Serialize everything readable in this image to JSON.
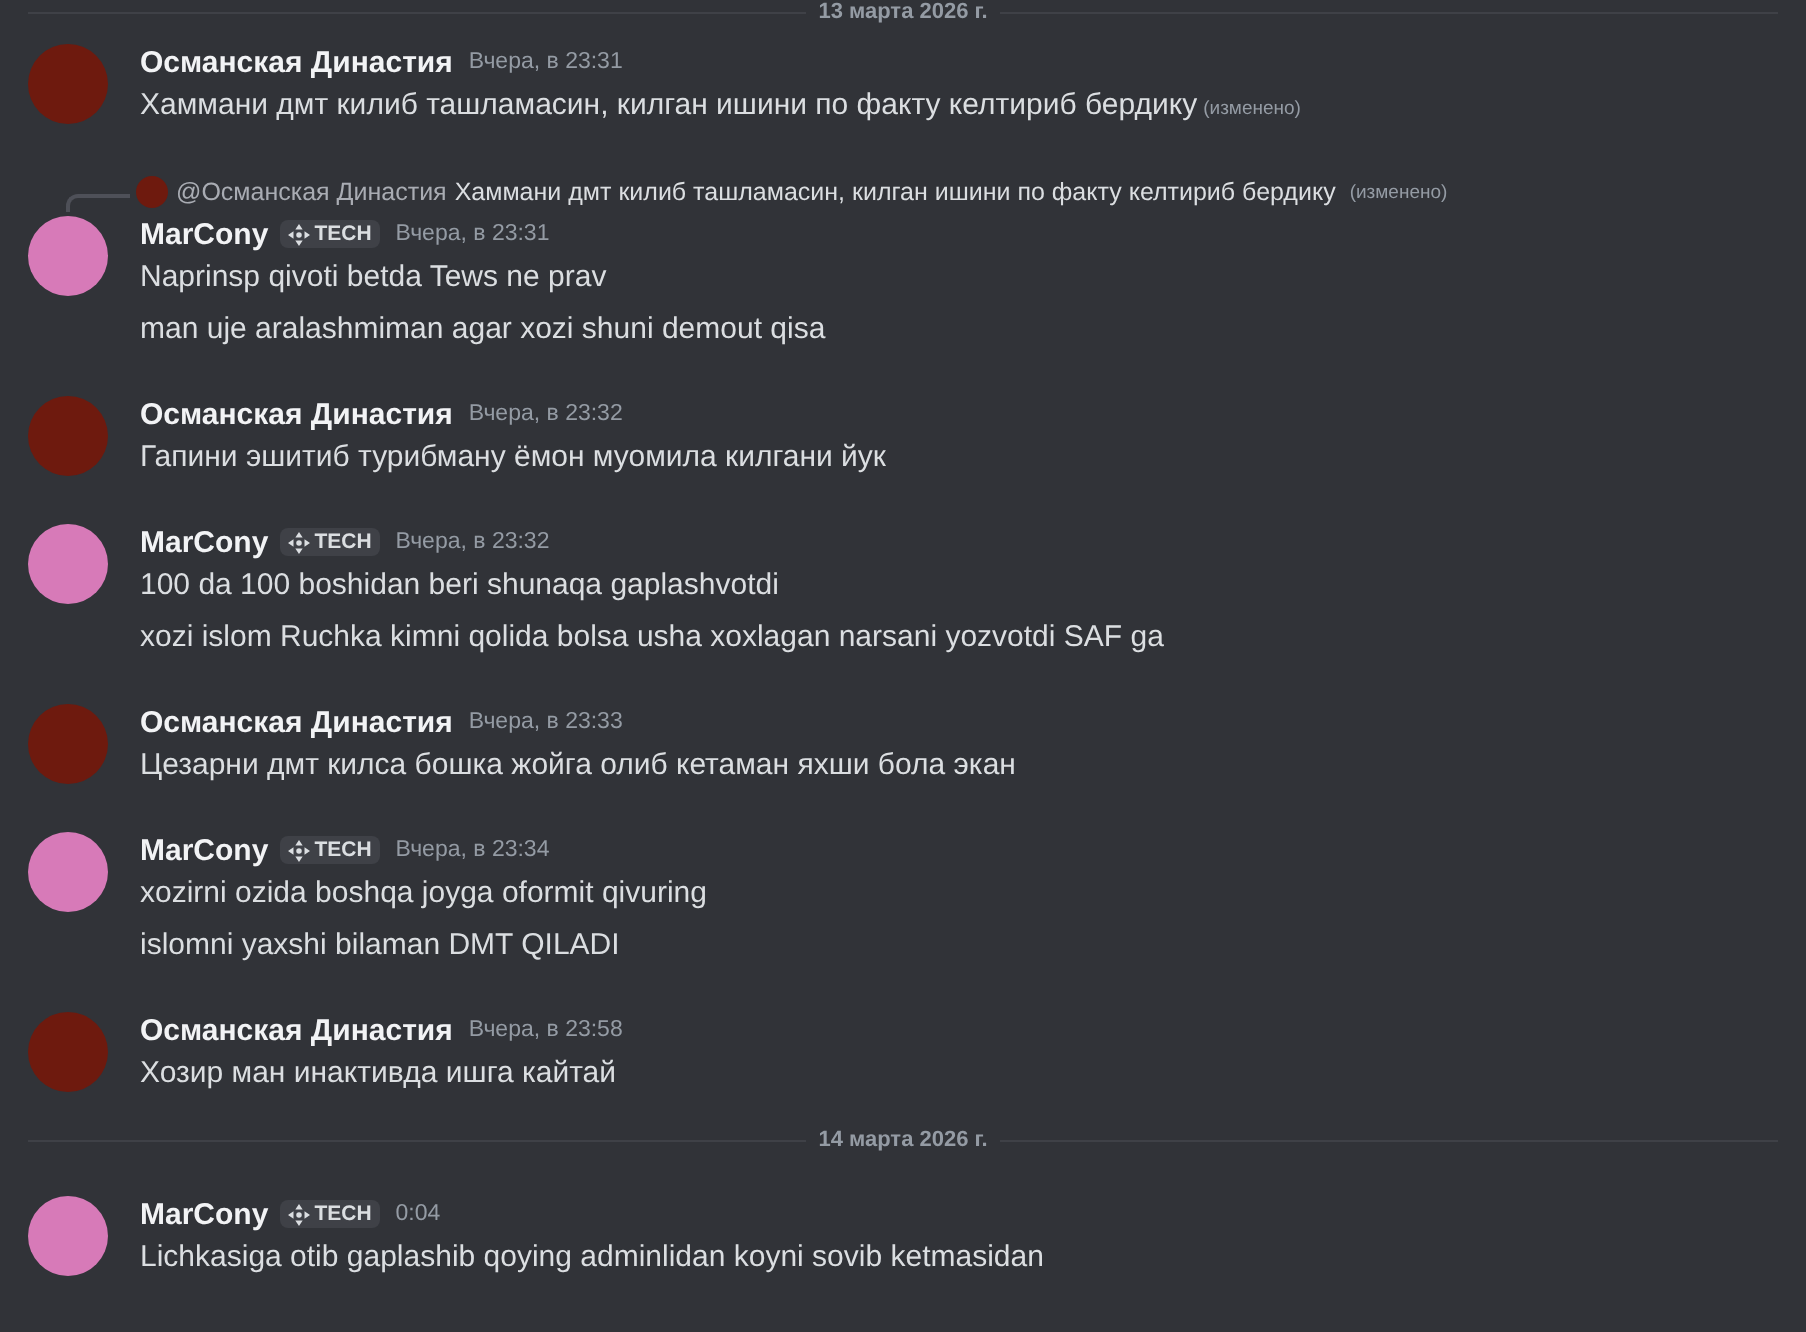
{
  "feed": [
    {
      "kind": "divider",
      "label": "13 марта 2026 г."
    },
    {
      "kind": "group",
      "author": "Османская Династия",
      "color": "#6e1a0e",
      "timestamp": "Вчера, в 23:31",
      "lines": [
        {
          "text": "Хаммани дмт килиб ташламасин, килган ишини по факту келтириб бердику",
          "edited": "(изменено)"
        }
      ]
    },
    {
      "kind": "group",
      "author": "MarCony",
      "color": "#d77ab8",
      "badge": "TECH",
      "timestamp": "Вчера, в 23:31",
      "reply": {
        "author": "@Османская Династия",
        "color": "#6e1a0e",
        "text": "Хаммани дмт килиб ташламасин, килган ишини по факту келтириб бердику",
        "edited": "(изменено)"
      },
      "lines": [
        {
          "text": "Naprinsp qivoti betda Tews ne prav"
        },
        {
          "text": "man uje aralashmiman agar xozi shuni demout qisa"
        }
      ]
    },
    {
      "kind": "group",
      "author": "Османская Династия",
      "color": "#6e1a0e",
      "timestamp": "Вчера, в 23:32",
      "lines": [
        {
          "text": "Гапини эшитиб турибману ёмон муомила килгани йук"
        }
      ]
    },
    {
      "kind": "group",
      "author": "MarCony",
      "color": "#d77ab8",
      "badge": "TECH",
      "timestamp": "Вчера, в 23:32",
      "lines": [
        {
          "text": "100 da 100 boshidan beri shunaqa gaplashvotdi"
        },
        {
          "text": "xozi islom Ruchka kimni qolida bolsa usha xoxlagan narsani yozvotdi SAF ga"
        }
      ]
    },
    {
      "kind": "group",
      "author": "Османская Династия",
      "color": "#6e1a0e",
      "timestamp": "Вчера, в 23:33",
      "lines": [
        {
          "text": "Цезарни дмт килса бошка жойга олиб кетаман яхши бола экан"
        }
      ]
    },
    {
      "kind": "group",
      "author": "MarCony",
      "color": "#d77ab8",
      "badge": "TECH",
      "timestamp": "Вчера, в 23:34",
      "lines": [
        {
          "text": "xozirni ozida boshqa joyga oformit qivuring"
        },
        {
          "text": "islomni yaxshi bilaman DMT QILADI"
        }
      ]
    },
    {
      "kind": "group",
      "author": "Османская Династия",
      "color": "#6e1a0e",
      "timestamp": "Вчера, в 23:58",
      "lines": [
        {
          "text": "Хозир ман инактивда ишга кайтай"
        }
      ]
    },
    {
      "kind": "divider",
      "label": "14 марта 2026 г."
    },
    {
      "kind": "group",
      "author": "MarCony",
      "color": "#d77ab8",
      "badge": "TECH",
      "timestamp": "0:04",
      "lines": [
        {
          "text": "Lichkasiga otib gaplashib qoying adminlidan koyni sovib ketmasidan"
        }
      ]
    }
  ]
}
